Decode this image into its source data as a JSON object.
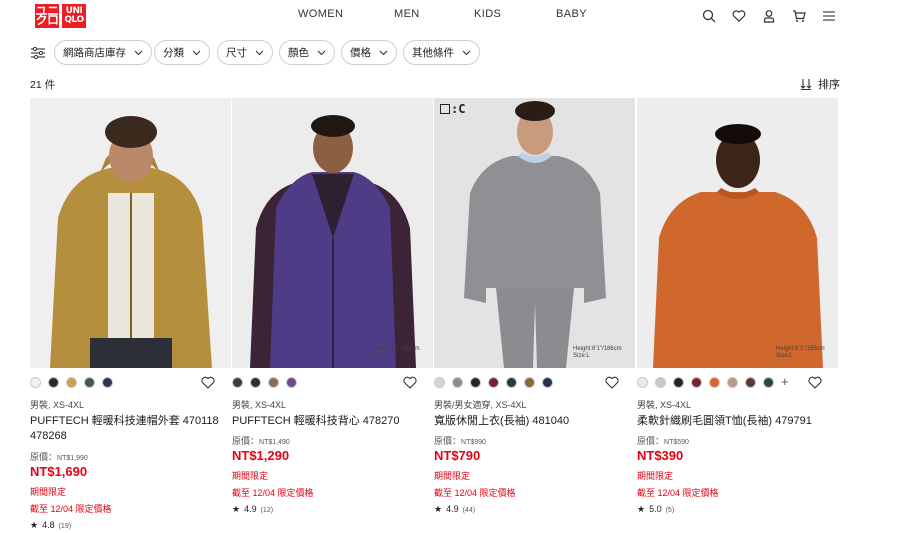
{
  "logo": {
    "line1": "ユニ",
    "line2": "クロ",
    "line3": "UNI",
    "line4": "QLO"
  },
  "nav": [
    "WOMEN",
    "MEN",
    "KIDS",
    "BABY"
  ],
  "icons": {
    "search": "search-icon",
    "wishlist": "heart-icon",
    "account": "user-icon",
    "cart": "cart-icon",
    "menu": "hamburger-menu-icon"
  },
  "filters": {
    "icon": "filter-sliders-icon",
    "chips": [
      "網路商店庫存",
      "分類",
      "尺寸",
      "顏色",
      "價格",
      "其他條件"
    ]
  },
  "results": {
    "count": "21 件",
    "sort_label": "排序"
  },
  "products": [
    {
      "colors": [
        "#f2f0ec",
        "#2b2b2b",
        "#c9a24f",
        "#3f5a56",
        "#2a3552"
      ],
      "more_colors": "",
      "category": "男裝, XS-4XL",
      "name": "PUFFTECH 輕暖科技連帽外套 470118 478268",
      "original_label": "原價：",
      "original_value": "NT$1,990",
      "price": "NT$1,690",
      "promo1": "期間限定",
      "promo2": "截至 12/04 限定價格",
      "rating": "4.8",
      "reviews": "(19)",
      "size_note": "",
      "brand_mark": ""
    },
    {
      "colors": [
        "#3a3d42",
        "#2f2f2f",
        "#8a6d55",
        "#6d4a8e"
      ],
      "more_colors": "",
      "category": "男裝, XS-4XL",
      "name": "PUFFTECH 輕暖科技背心 478270",
      "original_label": "原價：",
      "original_value": "NT$1,490",
      "price": "NT$1,290",
      "promo1": "期間限定",
      "promo2": "截至 12/04 限定價格",
      "rating": "4.9",
      "reviews": "(12)",
      "size_note": "Height:6'1\"/186cm Size:L",
      "brand_mark": ""
    },
    {
      "colors": [
        "#d4d4d4",
        "#8d8d8d",
        "#262626",
        "#7a1f2e",
        "#2e3a35",
        "#8a6a3a",
        "#24314d"
      ],
      "more_colors": "",
      "category": "男裝/男女適穿, XS-4XL",
      "name": "寬版休閒上衣(長袖) 481040",
      "original_label": "原價：",
      "original_value": "NT$990",
      "price": "NT$790",
      "promo1": "期間限定",
      "promo2": "截至 12/04 限定價格",
      "rating": "4.9",
      "reviews": "(44)",
      "size_note": "Height:6'1\"/186cm Size:L",
      "brand_mark": ":C"
    },
    {
      "colors": [
        "#ecebe4",
        "#c8c8c8",
        "#262626",
        "#7a2430",
        "#d4672e",
        "#b89a8a",
        "#5b3a30",
        "#2c4a3a"
      ],
      "more_colors": "+",
      "category": "男裝, XS-4XL",
      "name": "柔軟針織刷毛圓領T恤(長袖) 479791",
      "original_label": "原價：",
      "original_value": "NT$590",
      "price": "NT$390",
      "promo1": "期間限定",
      "promo2": "截至 12/04 限定價格",
      "rating": "5.0",
      "reviews": "(5)",
      "size_note": "Height:6'1\"/185cm Size:L",
      "brand_mark": ""
    }
  ]
}
